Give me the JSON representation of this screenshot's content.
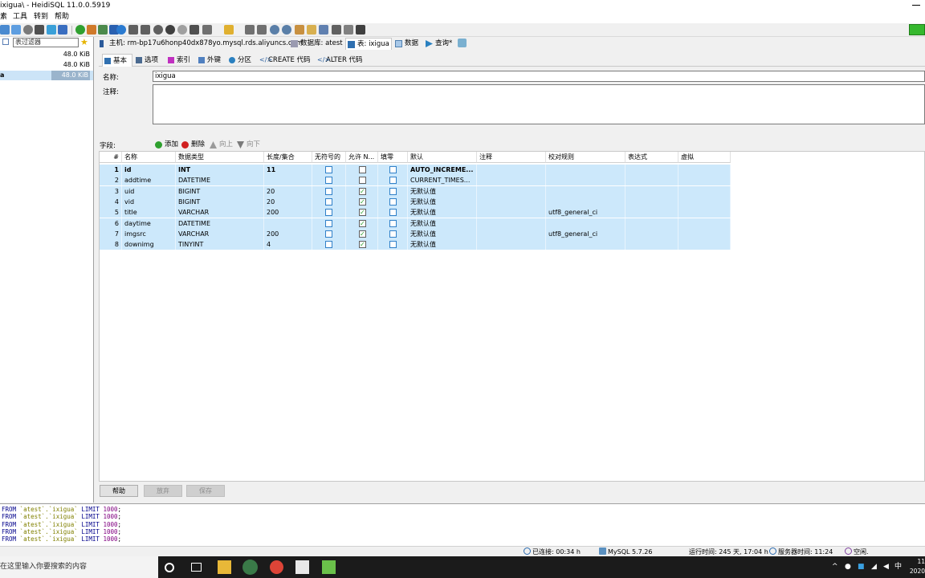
{
  "app": {
    "title": "ixigua\\ - HeidiSQL 11.0.0.5919"
  },
  "menu": [
    "素",
    "工具",
    "转到",
    "帮助"
  ],
  "left_panel": {
    "filter_placeholder": "表过滤器",
    "rows": [
      {
        "name": "",
        "size": "48.0 KiB",
        "selected": false
      },
      {
        "name": "",
        "size": "48.0 KiB",
        "selected": false
      },
      {
        "name": "a",
        "size": "48.0 KiB",
        "selected": true
      }
    ]
  },
  "main_tabs": [
    {
      "label": "主机: rm-bp17u6honp40dx878yo.mysql.rds.aliyuncs.com",
      "icon": "host-icon",
      "active": false
    },
    {
      "label": "数据库: atest",
      "icon": "database-icon",
      "active": false
    },
    {
      "label": "表: ixigua",
      "icon": "table-icon",
      "active": true
    },
    {
      "label": "数据",
      "icon": "grid-icon",
      "active": false
    },
    {
      "label": "查询*",
      "icon": "play-icon",
      "active": false
    }
  ],
  "sub_tabs": [
    {
      "label": "基本",
      "icon": "table-icon",
      "active": true
    },
    {
      "label": "选项",
      "icon": "wrench-icon",
      "active": false
    },
    {
      "label": "索引",
      "icon": "lightning-icon",
      "active": false
    },
    {
      "label": "外键",
      "icon": "foreign-key-icon",
      "active": false
    },
    {
      "label": "分区",
      "icon": "globe-icon",
      "active": false
    },
    {
      "label": "CREATE 代码",
      "icon": "code-icon",
      "active": false
    },
    {
      "label": "ALTER 代码",
      "icon": "code-icon",
      "active": false
    }
  ],
  "editor": {
    "name_label": "名称:",
    "name_value": "ixigua",
    "comment_label": "注释:",
    "comment_value": ""
  },
  "fields_bar": {
    "label": "字段:",
    "add": "添加",
    "delete": "删除",
    "up": "向上",
    "down": "向下"
  },
  "grid": {
    "headers": [
      "#",
      "名称",
      "数据类型",
      "长度/集合",
      "无符号的",
      "允许 N...",
      "填零",
      "默认",
      "注释",
      "校对规则",
      "表达式",
      "虚拟"
    ],
    "rows": [
      {
        "num": "1",
        "name": "id",
        "type": "INT",
        "length": "11",
        "unsigned": false,
        "allow_null": false,
        "zerofill": false,
        "default": "AUTO_INCREME...",
        "comment": "",
        "collation": "",
        "key": "primary",
        "bold": true
      },
      {
        "num": "2",
        "name": "addtime",
        "type": "DATETIME",
        "length": "",
        "unsigned": false,
        "allow_null": false,
        "zerofill": false,
        "default": "CURRENT_TIMES...",
        "comment": "",
        "collation": "",
        "key": "",
        "bold": false
      },
      {
        "num": "3",
        "name": "uid",
        "type": "BIGINT",
        "length": "20",
        "unsigned": false,
        "allow_null": true,
        "zerofill": false,
        "default": "无默认值",
        "comment": "",
        "collation": "",
        "key": "",
        "bold": false
      },
      {
        "num": "4",
        "name": "vid",
        "type": "BIGINT",
        "length": "20",
        "unsigned": false,
        "allow_null": true,
        "zerofill": false,
        "default": "无默认值",
        "comment": "",
        "collation": "",
        "key": "unique",
        "bold": false
      },
      {
        "num": "5",
        "name": "title",
        "type": "VARCHAR",
        "length": "200",
        "unsigned": false,
        "allow_null": true,
        "zerofill": false,
        "default": "无默认值",
        "comment": "",
        "collation": "utf8_general_ci",
        "key": "index",
        "bold": false
      },
      {
        "num": "6",
        "name": "daytime",
        "type": "DATETIME",
        "length": "",
        "unsigned": false,
        "allow_null": true,
        "zerofill": false,
        "default": "无默认值",
        "comment": "",
        "collation": "",
        "key": "",
        "bold": false
      },
      {
        "num": "7",
        "name": "imgsrc",
        "type": "VARCHAR",
        "length": "200",
        "unsigned": false,
        "allow_null": true,
        "zerofill": false,
        "default": "无默认值",
        "comment": "",
        "collation": "utf8_general_ci",
        "key": "",
        "bold": false
      },
      {
        "num": "8",
        "name": "downimg",
        "type": "TINYINT",
        "length": "4",
        "unsigned": false,
        "allow_null": true,
        "zerofill": false,
        "default": "无默认值",
        "comment": "",
        "collation": "",
        "key": "",
        "bold": false
      }
    ]
  },
  "buttons": {
    "help": "帮助",
    "discard": "放弃",
    "save": "保存"
  },
  "sql_log": [
    "FROM `atest`.`ixigua` LIMIT 1000;",
    "FROM `atest`.`ixigua` LIMIT 1000;",
    "FROM `atest`.`ixigua` LIMIT 1000;",
    "FROM `atest`.`ixigua` LIMIT 1000;",
    "FROM `atest`.`ixigua` LIMIT 1000;"
  ],
  "status_bar": {
    "connected": "已连接: 00:34 h",
    "server": "MySQL 5.7.26",
    "uptime": "运行时间: 245 天, 17:04 h",
    "server_time": "服务器时间: 11:24",
    "idle": "空闲."
  },
  "taskbar": {
    "search_placeholder": "在这里输入你要搜索的内容",
    "ime": "中",
    "time": "11",
    "date": "2020"
  },
  "colors": {
    "selection": "#cce8fb",
    "status_green": "#36b82e",
    "taskbar": "#1b1b1b"
  }
}
